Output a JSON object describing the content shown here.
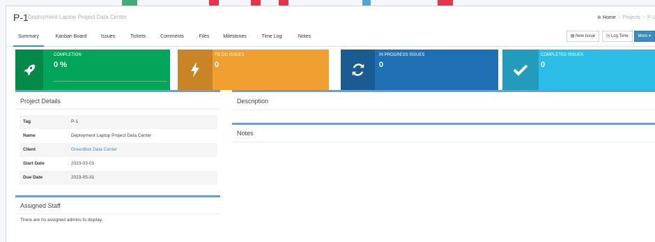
{
  "project": {
    "id": "P-1",
    "title": "Deployment Laptop Project Data Center"
  },
  "breadcrumb": {
    "home": "Home",
    "projects": "Projects",
    "current": "P-1"
  },
  "tabs": [
    {
      "label": "Summary",
      "active": true
    },
    {
      "label": "Kanban Board"
    },
    {
      "label": "Issues"
    },
    {
      "label": "Tickets"
    },
    {
      "label": "Comments"
    },
    {
      "label": "Files"
    },
    {
      "label": "Milestones"
    },
    {
      "label": "Time Log"
    },
    {
      "label": "Notes"
    }
  ],
  "actions": {
    "new_issue": "New Issue",
    "log_time": "Log Time",
    "more": "More"
  },
  "stats": [
    {
      "label": "COMPLETION",
      "value": "0 %",
      "icon": "rocket-icon",
      "color": "#03a55a",
      "icon_bg": "#038a4b"
    },
    {
      "label": "TO DO ISSUES",
      "value": "0",
      "icon": "bolt-icon",
      "color": "#f0a030",
      "icon_bg": "#c88425"
    },
    {
      "label": "IN PROGRESS ISSUES",
      "value": "0",
      "icon": "refresh-icon",
      "color": "#1f6fb4",
      "icon_bg": "#1a5b92"
    },
    {
      "label": "COMPLETED ISSUES",
      "value": "0",
      "icon": "check-icon",
      "color": "#2bbde5",
      "icon_bg": "#229bbd"
    }
  ],
  "project_details": {
    "heading": "Project Details",
    "rows": [
      {
        "label": "Tag",
        "value": "P-1"
      },
      {
        "label": "Name",
        "value": "Deployment Laptop Project Data Center"
      },
      {
        "label": "Client",
        "value": "GreenBox Data Center",
        "link": true
      },
      {
        "label": "Start Date",
        "value": "2023-03-01"
      },
      {
        "label": "Due Date",
        "value": "2023-05-31"
      }
    ]
  },
  "assigned_staff": {
    "heading": "Assigned Staff",
    "empty_text": "There are no assigned admins to display."
  },
  "description": {
    "heading": "Description"
  },
  "notes": {
    "heading": "Notes"
  }
}
